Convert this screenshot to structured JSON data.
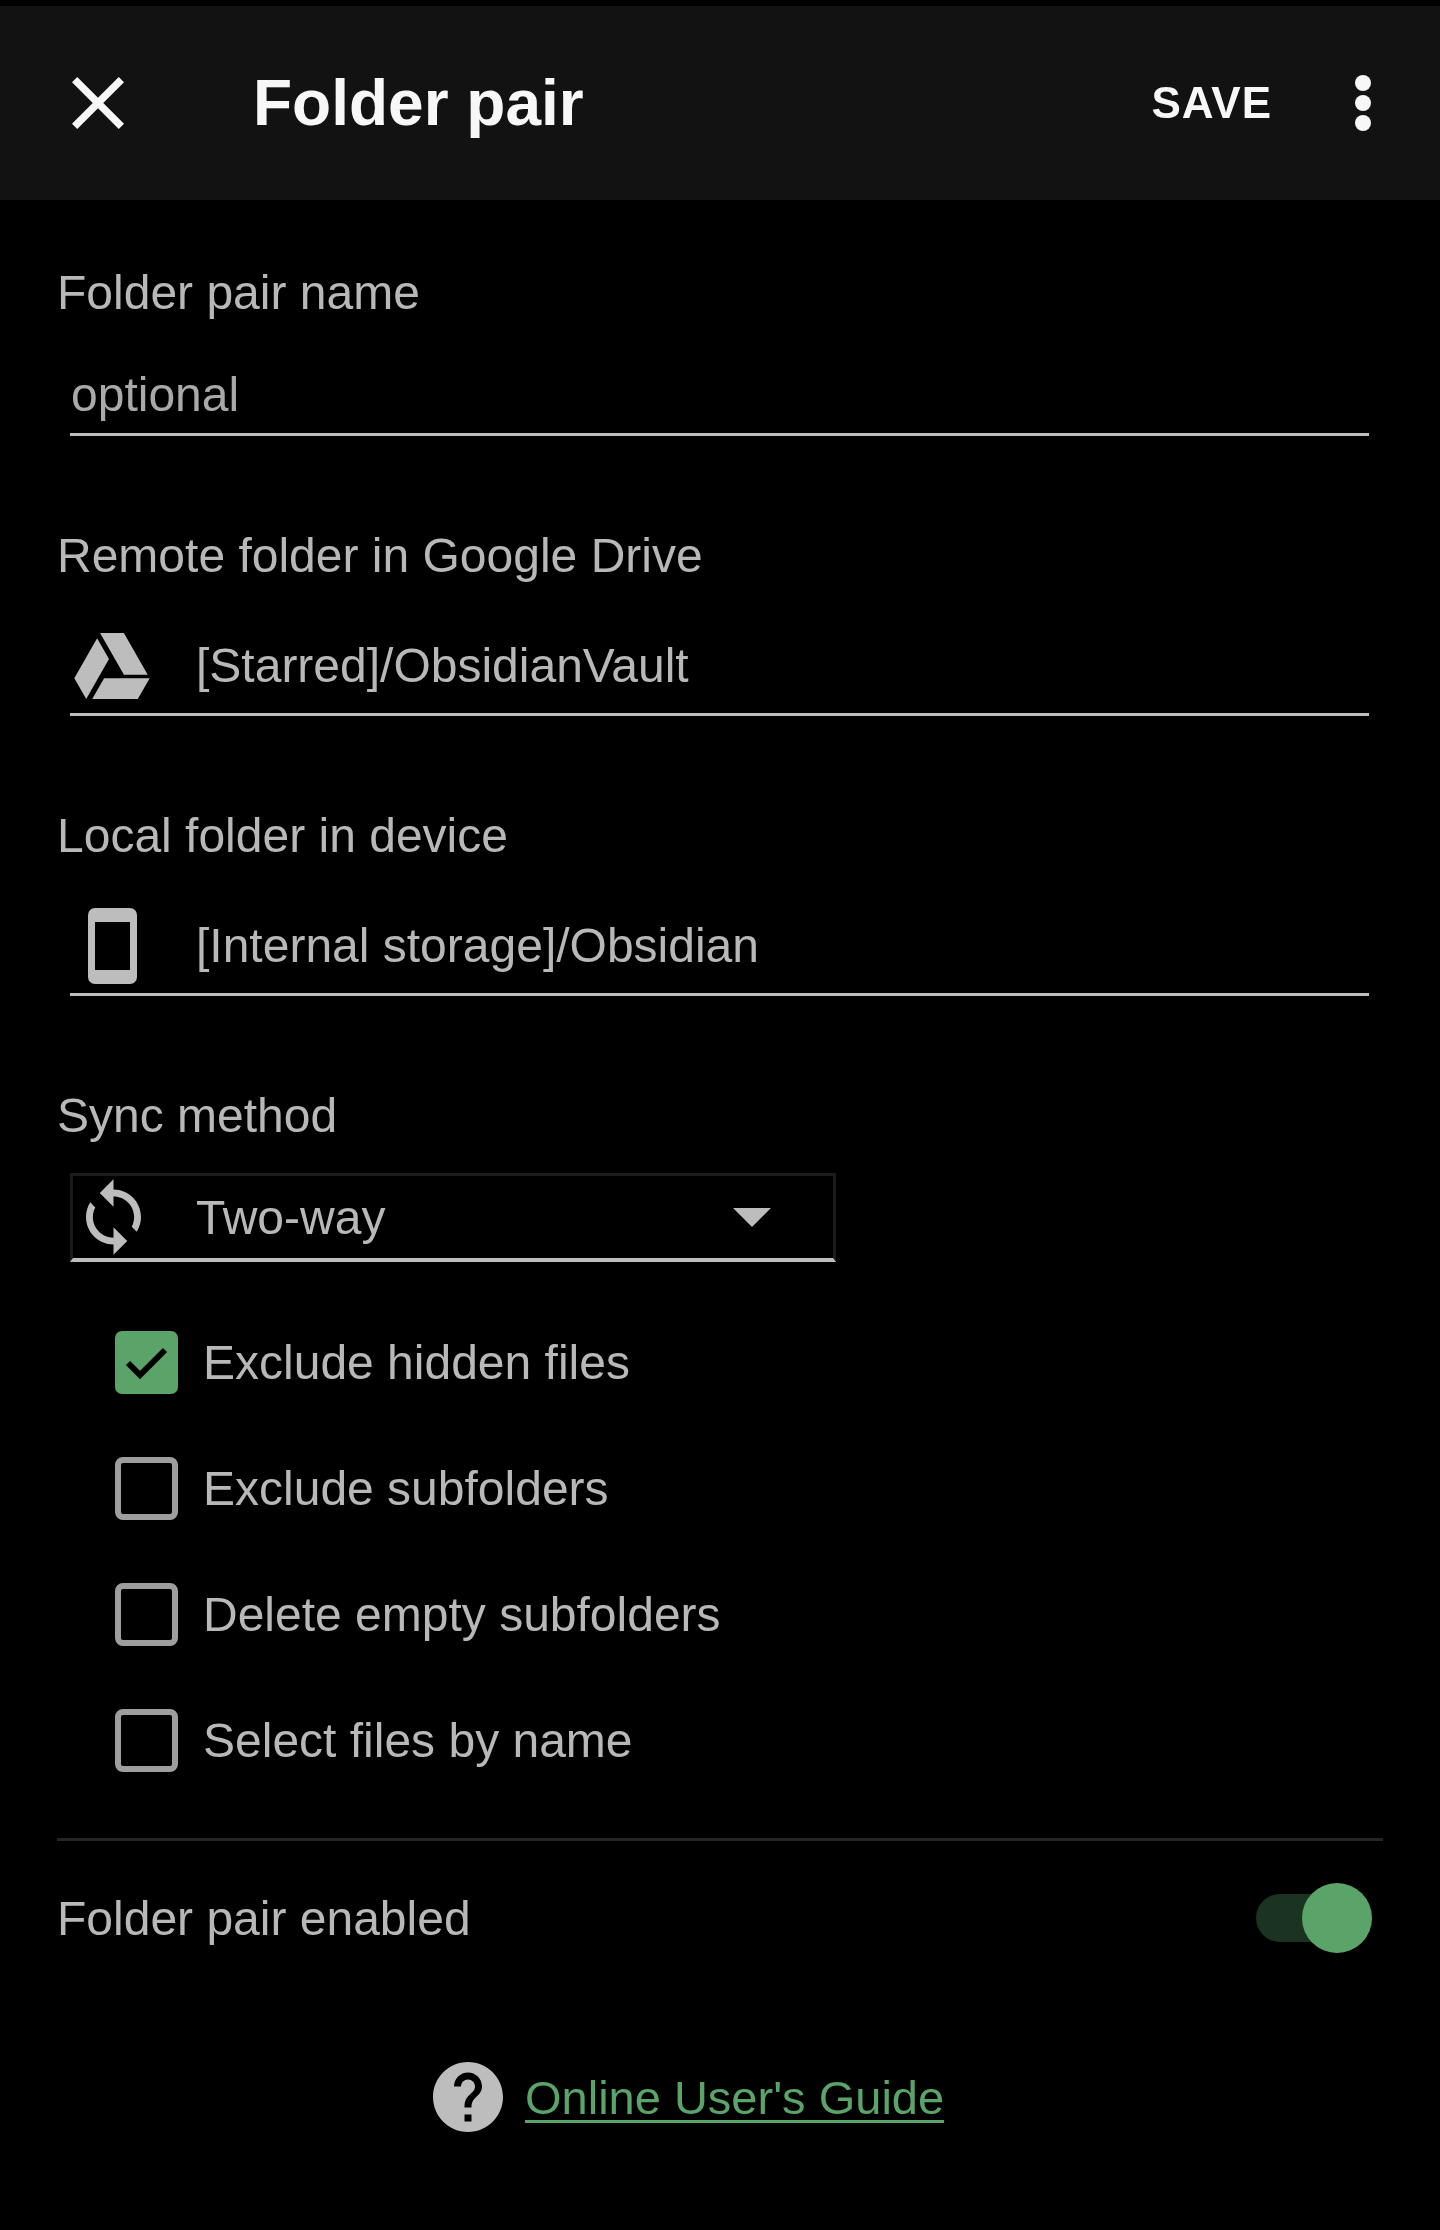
{
  "toolbar": {
    "title": "Folder pair",
    "action": "SAVE"
  },
  "fields": [
    {
      "kind": "text",
      "label": "Folder pair name",
      "placeholder": "optional"
    },
    {
      "kind": "drive",
      "label": "Remote folder in Google Drive",
      "value": "[Starred]/ObsidianVault"
    },
    {
      "kind": "device",
      "label": "Local folder in device",
      "value": "[Internal storage]/Obsidian"
    }
  ],
  "sync_method": {
    "label": "Sync method",
    "value": "Two-way"
  },
  "options": [
    {
      "label": "Exclude hidden files",
      "checked": true
    },
    {
      "label": "Exclude subfolders",
      "checked": false
    },
    {
      "label": "Delete empty subfolders",
      "checked": false
    },
    {
      "label": "Select files by name",
      "checked": false
    }
  ],
  "enabled": {
    "label": "Folder pair enabled",
    "on": true
  },
  "help_link": {
    "label": "Online User's Guide"
  }
}
